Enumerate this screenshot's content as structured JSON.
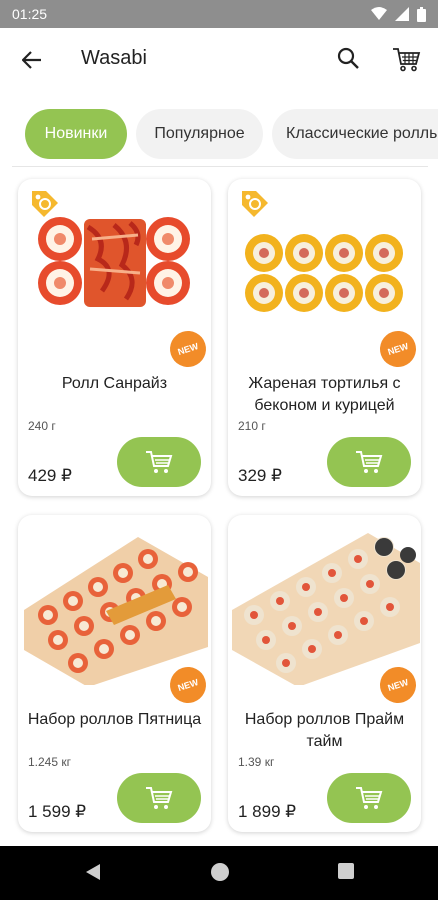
{
  "status": {
    "time": "01:25"
  },
  "header": {
    "title": "Wasabi"
  },
  "tabs": [
    "Новинки",
    "Популярное",
    "Классические роллы"
  ],
  "products": [
    {
      "name": "Ролл Санрайз",
      "weight": "240 г",
      "price": "429 ₽",
      "badge": "NEW"
    },
    {
      "name": "Жареная тортилья с беконом и курицей",
      "weight": "210 г",
      "price": "329 ₽",
      "badge": "NEW"
    },
    {
      "name": "Набор роллов Пятница",
      "weight": "1.245 кг",
      "price": "1 599 ₽",
      "badge": "NEW"
    },
    {
      "name": "Набор роллов Прайм тайм",
      "weight": "1.39 кг",
      "price": "1 899 ₽",
      "badge": "NEW"
    }
  ],
  "colors": {
    "accent": "#94c452",
    "badge": "#f28c28",
    "tag": "#f5b82e"
  }
}
